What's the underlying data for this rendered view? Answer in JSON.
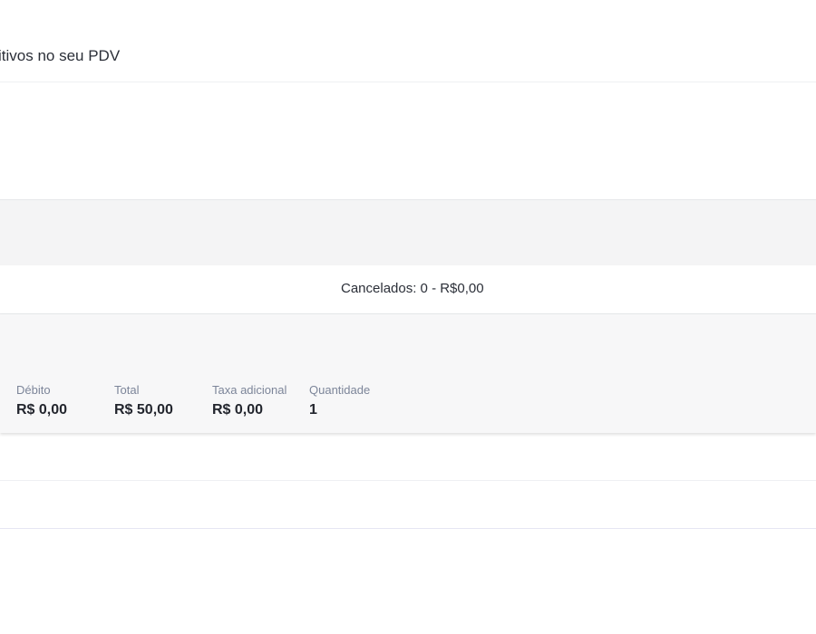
{
  "header": {
    "subtitle": "itivos no seu PDV"
  },
  "cancelled": {
    "text": "Cancelados: 0 - R$0,00"
  },
  "summary": {
    "stats": [
      {
        "label": "Débito",
        "value": "R$ 0,00"
      },
      {
        "label": "Total",
        "value": "R$ 50,00"
      },
      {
        "label": "Taxa adicional",
        "value": "R$ 0,00"
      },
      {
        "label": "Quantidade",
        "value": "1"
      }
    ]
  }
}
